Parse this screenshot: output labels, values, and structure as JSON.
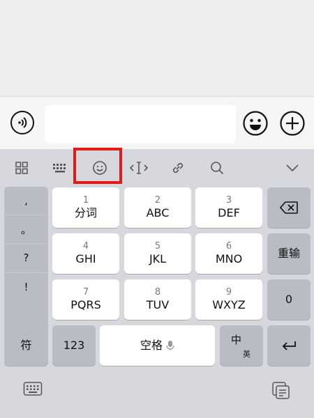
{
  "input_bar": {
    "voice_icon": "voice-icon",
    "emoji_icon": "emoji-icon",
    "plus_icon": "plus-icon",
    "text_value": ""
  },
  "toolbar": {
    "icons": [
      "grid-icon",
      "keyboard-icon",
      "emoji-icon",
      "cursor-icon",
      "link-icon",
      "search-icon",
      "chevron-down-icon"
    ],
    "highlight_color": "#e01b1b"
  },
  "punctuation": [
    ",",
    "。",
    "?",
    "!"
  ],
  "keys": {
    "k1": {
      "num": "1",
      "label": "分词"
    },
    "k2": {
      "num": "2",
      "label": "ABC"
    },
    "k3": {
      "num": "3",
      "label": "DEF"
    },
    "k4": {
      "num": "4",
      "label": "GHI"
    },
    "k5": {
      "num": "5",
      "label": "JKL"
    },
    "k6": {
      "num": "6",
      "label": "MNO"
    },
    "k7": {
      "num": "7",
      "label": "PQRS"
    },
    "k8": {
      "num": "8",
      "label": "TUV"
    },
    "k9": {
      "num": "9",
      "label": "WXYZ"
    },
    "reenter": "重输",
    "zero": "0",
    "symbol": "符",
    "num123": "123",
    "space": "空格",
    "lang_main": "中",
    "lang_sub": "英"
  },
  "bottom": {
    "left_icon": "keyboard-switch-icon",
    "right_icon": "clipboard-icon"
  }
}
